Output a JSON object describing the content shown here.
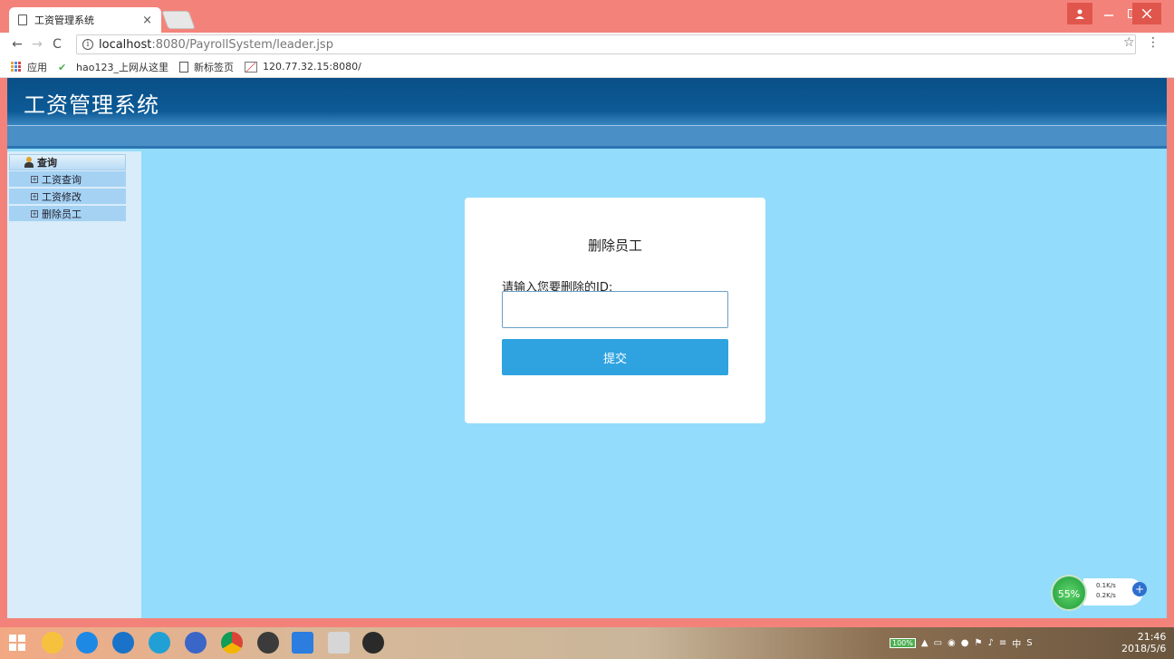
{
  "browser": {
    "tab_title": "工资管理系统",
    "tab_close": "×",
    "url_host": "localhost",
    "url_rest": ":8080/PayrollSystem/leader.jsp",
    "star": "☆",
    "menu": "⋮",
    "bookmarks": [
      {
        "label": "应用",
        "icon": "apps-icon"
      },
      {
        "label": "hao123_上网从这里",
        "icon": "hao123-icon"
      },
      {
        "label": "新标签页",
        "icon": "page-icon"
      },
      {
        "label": "120.77.32.15:8080/",
        "icon": "chart-icon"
      }
    ]
  },
  "header": {
    "title": "工资管理系统"
  },
  "sidebar": {
    "head": "查询",
    "items": [
      {
        "label": "工资查询"
      },
      {
        "label": "工资修改"
      },
      {
        "label": "删除员工"
      }
    ]
  },
  "form": {
    "title": "删除员工",
    "label": "请输入您要删除的ID:",
    "input_value": "",
    "input_placeholder": "",
    "submit_label": "提交"
  },
  "ime": {
    "lang": "中"
  },
  "net": {
    "percent": "55%",
    "up": "0.1K/s",
    "down": "0.2K/s"
  },
  "taskbar": {
    "battery": "100%",
    "tray_lang": "中",
    "time": "21:46",
    "date": "2018/5/6"
  },
  "colors": {
    "titlebar": "#f3837a",
    "header": "#0c5a96",
    "page_bg": "#93dcfb",
    "sidebar_bg": "#d9ecfa",
    "submit": "#2fa3e0"
  }
}
